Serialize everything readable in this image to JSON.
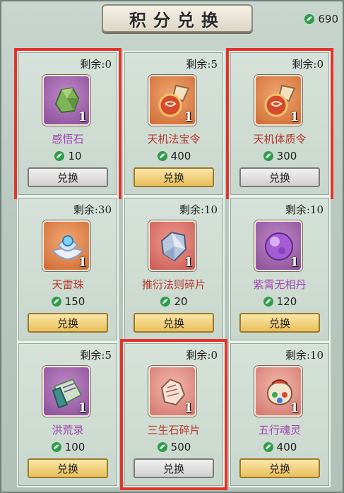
{
  "header": {
    "title": "积分兑换",
    "currency_value": "690",
    "currency_icon": "jade-leaf-icon"
  },
  "colors": {
    "purple_text": "#a345b3",
    "red_text": "#b8372c",
    "selection": "#e5332a"
  },
  "items": [
    {
      "remain": "剩余:0",
      "name": "感悟石",
      "price": "10",
      "qty": "1",
      "button": "兑换",
      "state": "disabled",
      "icon": "green-crystal-icon",
      "bg": "purple",
      "name_color": "purple",
      "selected": true
    },
    {
      "remain": "剩余:5",
      "name": "天机法宝令",
      "price": "400",
      "qty": "1",
      "button": "兑换",
      "state": "active",
      "icon": "talisman-token-icon",
      "bg": "orange",
      "name_color": "red",
      "selected": false
    },
    {
      "remain": "剩余:0",
      "name": "天机体质令",
      "price": "300",
      "qty": "1",
      "button": "兑换",
      "state": "disabled",
      "icon": "talisman-token-icon",
      "bg": "orange",
      "name_color": "red",
      "selected": true
    },
    {
      "remain": "剩余:30",
      "name": "天雷珠",
      "price": "150",
      "qty": "1",
      "button": "兑换",
      "state": "active",
      "icon": "lotus-pearl-icon",
      "bg": "orange",
      "name_color": "red",
      "selected": false
    },
    {
      "remain": "剩余:10",
      "name": "推衍法则碎片",
      "price": "20",
      "qty": "1",
      "button": "兑换",
      "state": "active",
      "icon": "crystal-shard-icon",
      "bg": "red",
      "name_color": "red",
      "selected": false
    },
    {
      "remain": "剩余:10",
      "name": "紫霄无相丹",
      "price": "120",
      "qty": "1",
      "button": "兑换",
      "state": "active",
      "icon": "purple-orb-icon",
      "bg": "purple",
      "name_color": "purple",
      "selected": false
    },
    {
      "remain": "剩余:5",
      "name": "洪荒录",
      "price": "100",
      "qty": "1",
      "button": "兑换",
      "state": "active",
      "icon": "scroll-book-icon",
      "bg": "purple",
      "name_color": "purple",
      "selected": false
    },
    {
      "remain": "剩余:0",
      "name": "三生石碎片",
      "price": "500",
      "qty": "1",
      "button": "兑换",
      "state": "disabled",
      "icon": "stone-fragment-icon",
      "bg": "lightred",
      "name_color": "red",
      "selected": true
    },
    {
      "remain": "剩余:10",
      "name": "五行魂灵",
      "price": "400",
      "qty": "1",
      "button": "兑换",
      "state": "active",
      "icon": "spirit-pouch-icon",
      "bg": "lightred",
      "name_color": "purple",
      "selected": false
    }
  ]
}
